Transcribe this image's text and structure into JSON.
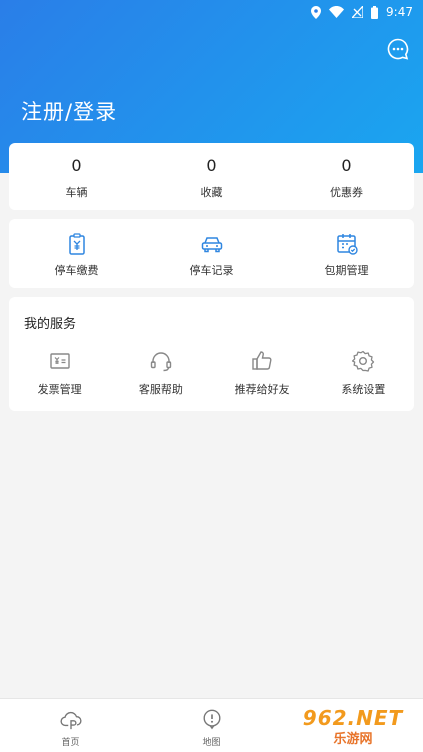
{
  "status_bar": {
    "time": "9:47"
  },
  "header": {
    "login_label": "注册/登录",
    "message_icon": "chat-bubble-icon"
  },
  "stats": [
    {
      "value": "0",
      "label": "车辆"
    },
    {
      "value": "0",
      "label": "收藏"
    },
    {
      "value": "0",
      "label": "优惠券"
    }
  ],
  "quick_actions": [
    {
      "label": "停车缴费",
      "icon": "parking-payment-icon"
    },
    {
      "label": "停车记录",
      "icon": "car-icon"
    },
    {
      "label": "包期管理",
      "icon": "calendar-icon"
    }
  ],
  "services": {
    "title": "我的服务",
    "items": [
      {
        "label": "发票管理",
        "icon": "invoice-icon"
      },
      {
        "label": "客服帮助",
        "icon": "headset-icon"
      },
      {
        "label": "推荐给好友",
        "icon": "thumbs-up-icon"
      },
      {
        "label": "系统设置",
        "icon": "gear-icon"
      }
    ]
  },
  "tabbar": [
    {
      "label": "首页",
      "icon": "home-logo-icon"
    },
    {
      "label": "地图",
      "icon": "map-pin-icon"
    }
  ],
  "watermark": {
    "top": "962.NET",
    "bottom": "乐游网"
  },
  "colors": {
    "header_start": "#2a7ee8",
    "header_end": "#1aa6f0",
    "icon_blue": "#2f86e0",
    "icon_gray": "#888888"
  }
}
